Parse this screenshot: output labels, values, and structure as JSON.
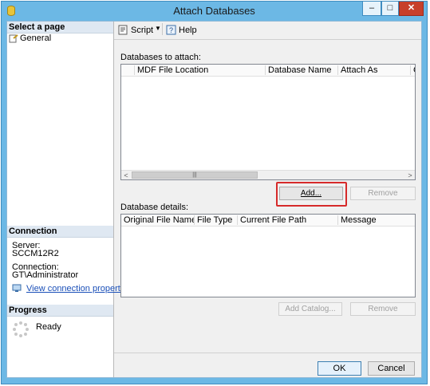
{
  "window": {
    "title": "Attach Databases",
    "icon": "database-icon"
  },
  "title_controls": {
    "minimize": "–",
    "maximize": "□",
    "close": "✕"
  },
  "left_pane": {
    "select_page_header": "Select a page",
    "pages": [
      {
        "label": "General",
        "icon": "page-icon"
      }
    ],
    "connection_header": "Connection",
    "server_label": "Server:",
    "server_value": "SCCM12R2",
    "connection_label": "Connection:",
    "connection_value": "GT\\Administrator",
    "view_connection_link": "View connection properties",
    "progress_header": "Progress",
    "progress_status": "Ready"
  },
  "toolbar": {
    "script_label": "Script",
    "help_label": "Help"
  },
  "databases_to_attach": {
    "label": "Databases to attach:",
    "columns": [
      "MDF File Location",
      "Database Name",
      "Attach As",
      "C"
    ],
    "rows": [],
    "add_button": "Add...",
    "remove_button": "Remove"
  },
  "database_details": {
    "label": "Database details:",
    "columns": [
      "Original File Name",
      "File Type",
      "Current File Path",
      "Message"
    ],
    "rows": [],
    "add_catalog_button": "Add Catalog...",
    "remove_button": "Remove"
  },
  "footer": {
    "ok_button": "OK",
    "cancel_button": "Cancel"
  },
  "colors": {
    "title_bar": "#6cb8e5",
    "highlight_box": "#d62a2a",
    "link": "#1a4fb8",
    "close_button": "#c7402b"
  }
}
